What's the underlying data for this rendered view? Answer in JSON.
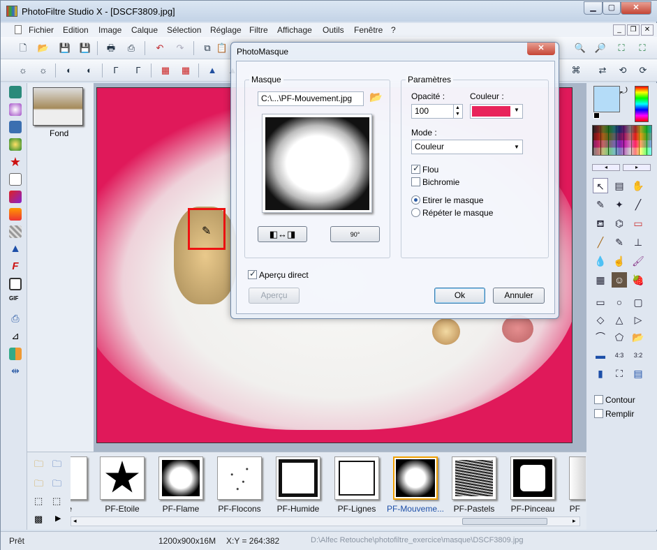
{
  "window": {
    "title": "PhotoFiltre Studio X - [DSCF3809.jpg]"
  },
  "menu": [
    "Fichier",
    "Edition",
    "Image",
    "Calque",
    "Sélection",
    "Réglage",
    "Filtre",
    "Affichage",
    "Outils",
    "Fenêtre",
    "?"
  ],
  "layers": {
    "items": [
      {
        "label": "Fond"
      }
    ]
  },
  "dialog": {
    "title": "PhotoMasque",
    "masque_label": "Masque",
    "file_path": "C:\\...\\PF-Mouvement.jpg",
    "parametres_label": "Paramètres",
    "opacite_label": "Opacité :",
    "opacite_value": "100",
    "couleur_label": "Couleur :",
    "couleur_value": "#e8245b",
    "mode_label": "Mode :",
    "mode_value": "Couleur",
    "flou_label": "Flou",
    "flou_checked": true,
    "bichromie_label": "Bichromie",
    "bichromie_checked": false,
    "etirer_label": "Etirer le masque",
    "repeter_label": "Répéter le masque",
    "stretch_selected": "etirer",
    "apercu_direct_label": "Aperçu direct",
    "apercu_direct_checked": true,
    "apercu_button": "Aperçu",
    "ok_button": "Ok",
    "annuler_button": "Annuler",
    "rotate_label": "90°"
  },
  "masks": {
    "items": [
      {
        "label": "nge"
      },
      {
        "label": "PF-Etoile"
      },
      {
        "label": "PF-Flame"
      },
      {
        "label": "PF-Flocons"
      },
      {
        "label": "PF-Humide"
      },
      {
        "label": "PF-Lignes"
      },
      {
        "label": "PF-Mouveme..."
      },
      {
        "label": "PF-Pastels"
      },
      {
        "label": "PF-Pinceau"
      },
      {
        "label": "PF"
      }
    ],
    "selected": "PF-Mouveme..."
  },
  "options": {
    "contour_label": "Contour",
    "remplir_label": "Remplir"
  },
  "status": {
    "state": "Prêt",
    "dimensions": "1200x900x16M",
    "coords": "X:Y = 264:382",
    "path": "D:\\Alfec Retouche\\photofiltre_exercice\\masque\\DSCF3809.jpg"
  },
  "colors": {
    "foreground": "#b4dcf8",
    "background": "#000000",
    "image_bg": "#e0195a"
  }
}
